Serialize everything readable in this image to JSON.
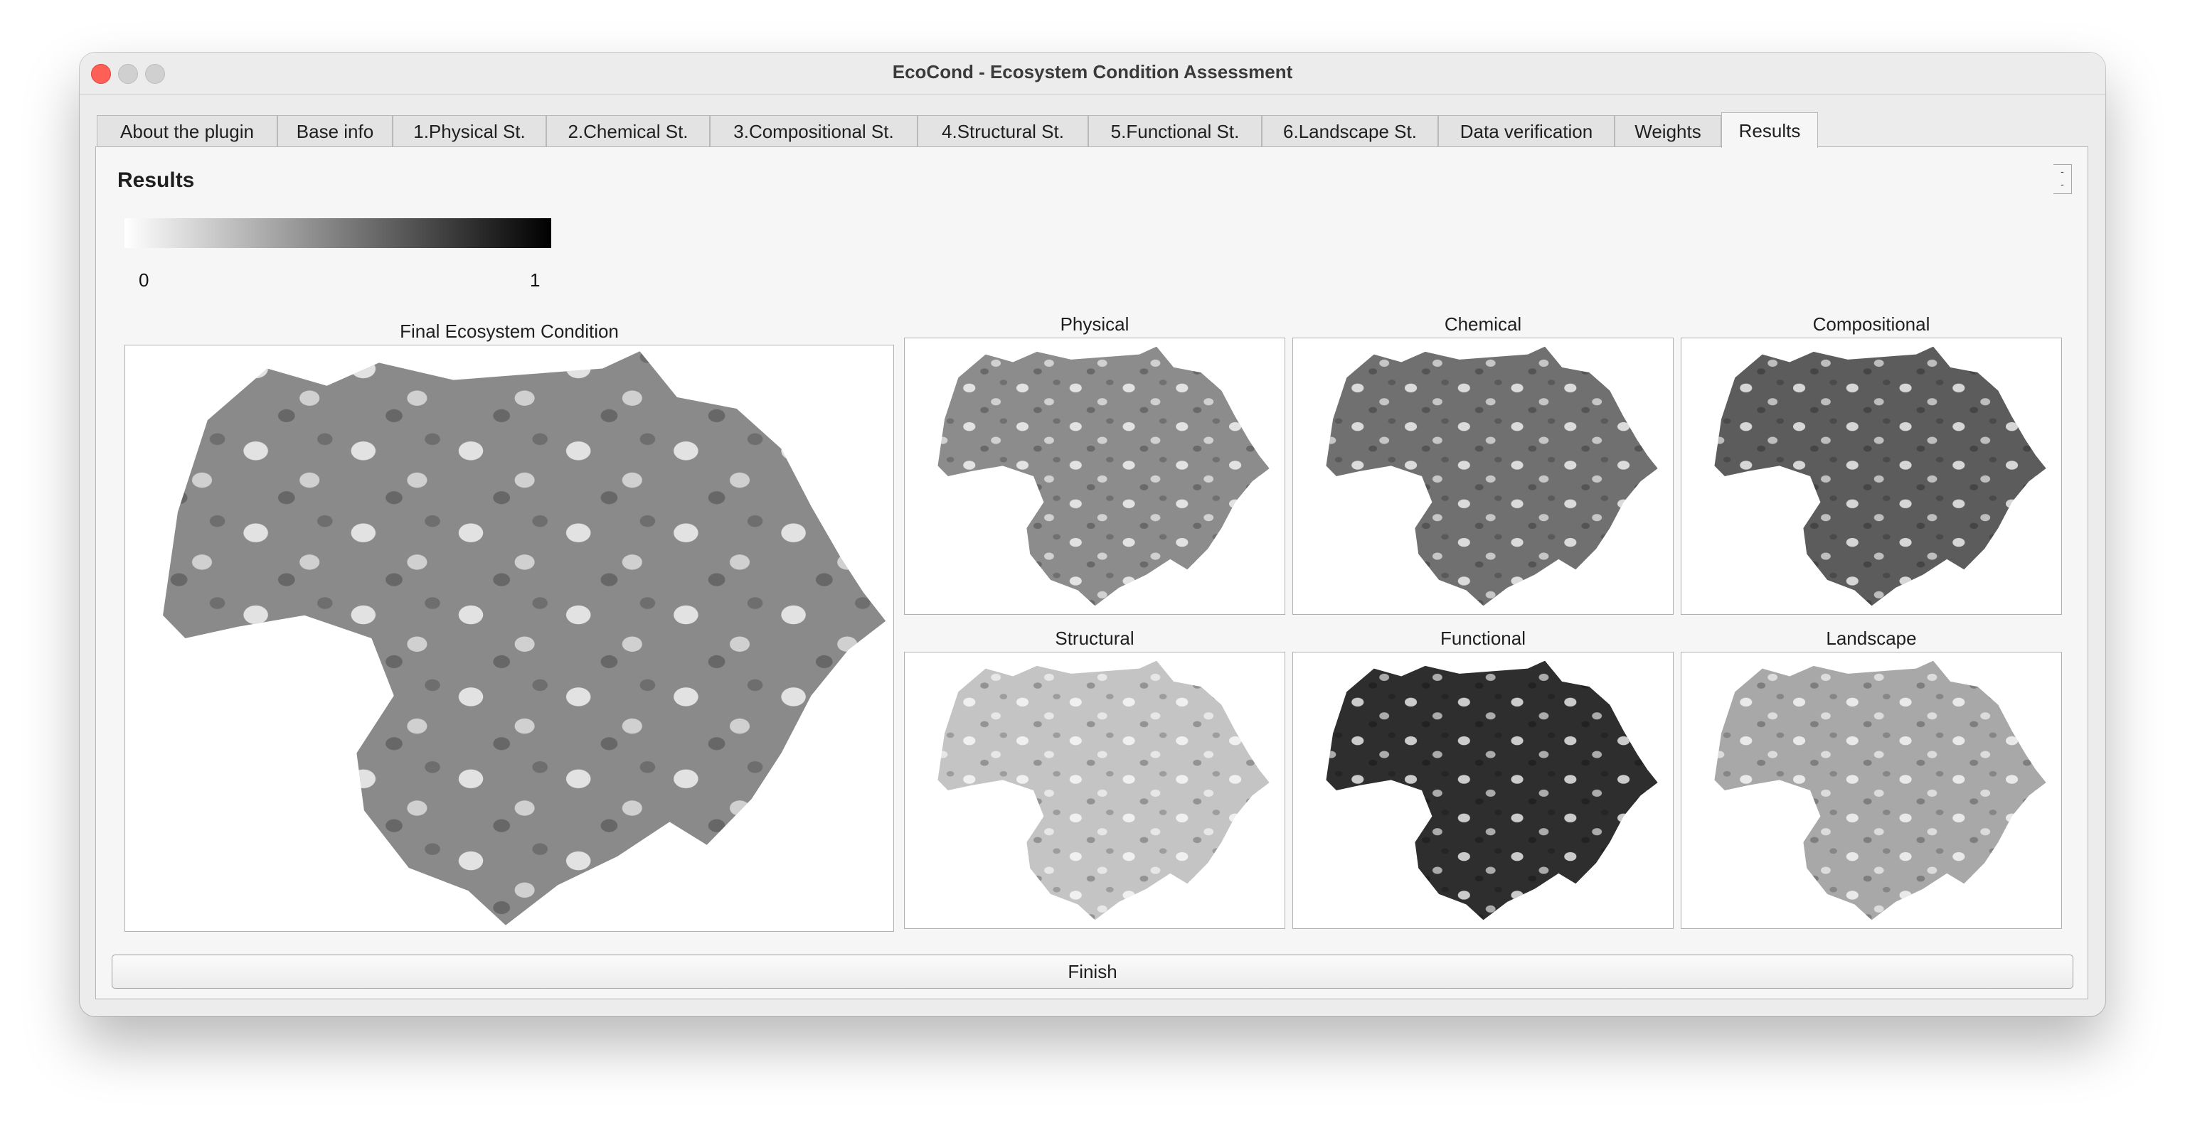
{
  "window": {
    "title": "EcoCond - Ecosystem Condition Assessment"
  },
  "tabs": [
    {
      "label": "About the plugin"
    },
    {
      "label": "Base info"
    },
    {
      "label": "1.Physical St."
    },
    {
      "label": "2.Chemical St."
    },
    {
      "label": "3.Compositional St."
    },
    {
      "label": "4.Structural St."
    },
    {
      "label": "5.Functional St."
    },
    {
      "label": "6.Landscape St."
    },
    {
      "label": "Data verification"
    },
    {
      "label": "Weights"
    },
    {
      "label": "Results"
    }
  ],
  "active_tab": "Results",
  "results": {
    "heading": "Results",
    "legend": {
      "min": "0",
      "max": "1",
      "gradient_start": "#ffffff",
      "gradient_end": "#000000"
    },
    "maps": {
      "final": {
        "title": "Final Ecosystem Condition",
        "base_color": "#8a8a8a"
      },
      "physical": {
        "title": "Physical",
        "base_color": "#8c8c8c"
      },
      "chemical": {
        "title": "Chemical",
        "base_color": "#707070"
      },
      "compositional": {
        "title": "Compositional",
        "base_color": "#5c5c5c"
      },
      "structural": {
        "title": "Structural",
        "base_color": "#c4c4c4"
      },
      "functional": {
        "title": "Functional",
        "base_color": "#2e2e2e"
      },
      "landscape": {
        "title": "Landscape",
        "base_color": "#a8a8a8"
      }
    }
  },
  "footer": {
    "finish_label": "Finish"
  }
}
